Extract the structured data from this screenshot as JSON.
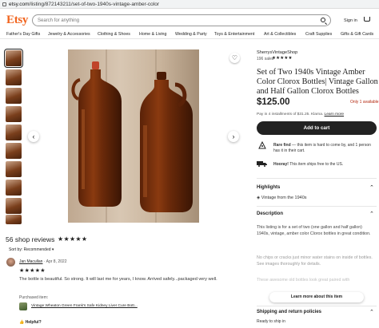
{
  "browser": {
    "url_host": "etsy.com",
    "url_path": "/listing/872143211/set-of-two-1940s-vintage-amber-color"
  },
  "header": {
    "logo": "Etsy",
    "search_placeholder": "Search for anything",
    "signin": "Sign in"
  },
  "categories": [
    "Father's Day Gifts",
    "Jewelry & Accessories",
    "Clothing & Shoes",
    "Home & Living",
    "Wedding & Party",
    "Toys & Entertainment",
    "Art & Collectibles",
    "Craft Supplies",
    "Gifts & Gift Cards"
  ],
  "listing": {
    "shop": "SherrysVintageShop",
    "sales": "196 sales",
    "stars": "★★★★★",
    "title": "Set of Two 1940s Vintage Amber Color Clorox Bottles| Vintage Gallon and Half Gallon Clorox Bottles",
    "price": "$125.00",
    "availability": "Only 1 available",
    "klarna_text": "Pay in 4 installments of $31.25. Klarna.",
    "klarna_link": "Learn more",
    "add_to_cart": "Add to cart",
    "rare_find_bold": "Rare find",
    "rare_find": " — this item is hard to come by, and 1 person has it in their cart.",
    "shipping_bold": "Hooray!",
    "shipping": " This item ships free to the US.",
    "highlights_header": "Highlights",
    "highlight_1": "Vintage from the 1940s",
    "description_header": "Description",
    "description_1": "This listing is for a set of two (one gallon and half gallon) 1940s, vintage, amber color Clorox bottles in great condition.",
    "description_2": "No chips or cracks just minor water stains on inside of bottles. See images thoroughly for details.",
    "description_3": "These awesome old bottles look great paired with",
    "learn_more": "Learn more about this item",
    "shipping_header": "Shipping and return policies",
    "ready_ship": "Ready to ship in"
  },
  "reviews": {
    "header": "56 shop reviews",
    "stars": "★★★★★",
    "sort": "Sort by: Recommended ▾",
    "reviewer": "Jan Macullan",
    "date": "· Apr 8, 2022",
    "review_stars": "★★★★★",
    "text": "The bottle is beautiful. So strong. It will last me for years, I know. Arrived safely...packaged very well.",
    "purchased_label": "Purchased item:",
    "purchased_item": "Vintage Wheaton Green Frank's Safe Kidney Liver Cure Bott...",
    "helpful": "Helpful?"
  },
  "colors": {
    "brand": "#f1641e",
    "price_alert": "#b3280f"
  },
  "icons": [
    "lock-icon",
    "search-icon",
    "cart-icon",
    "heart-icon",
    "chevron-left-icon",
    "chevron-right-icon",
    "rare-find-icon",
    "truck-icon",
    "highlight-icon",
    "chevron-down-icon",
    "thumbs-up-icon"
  ]
}
